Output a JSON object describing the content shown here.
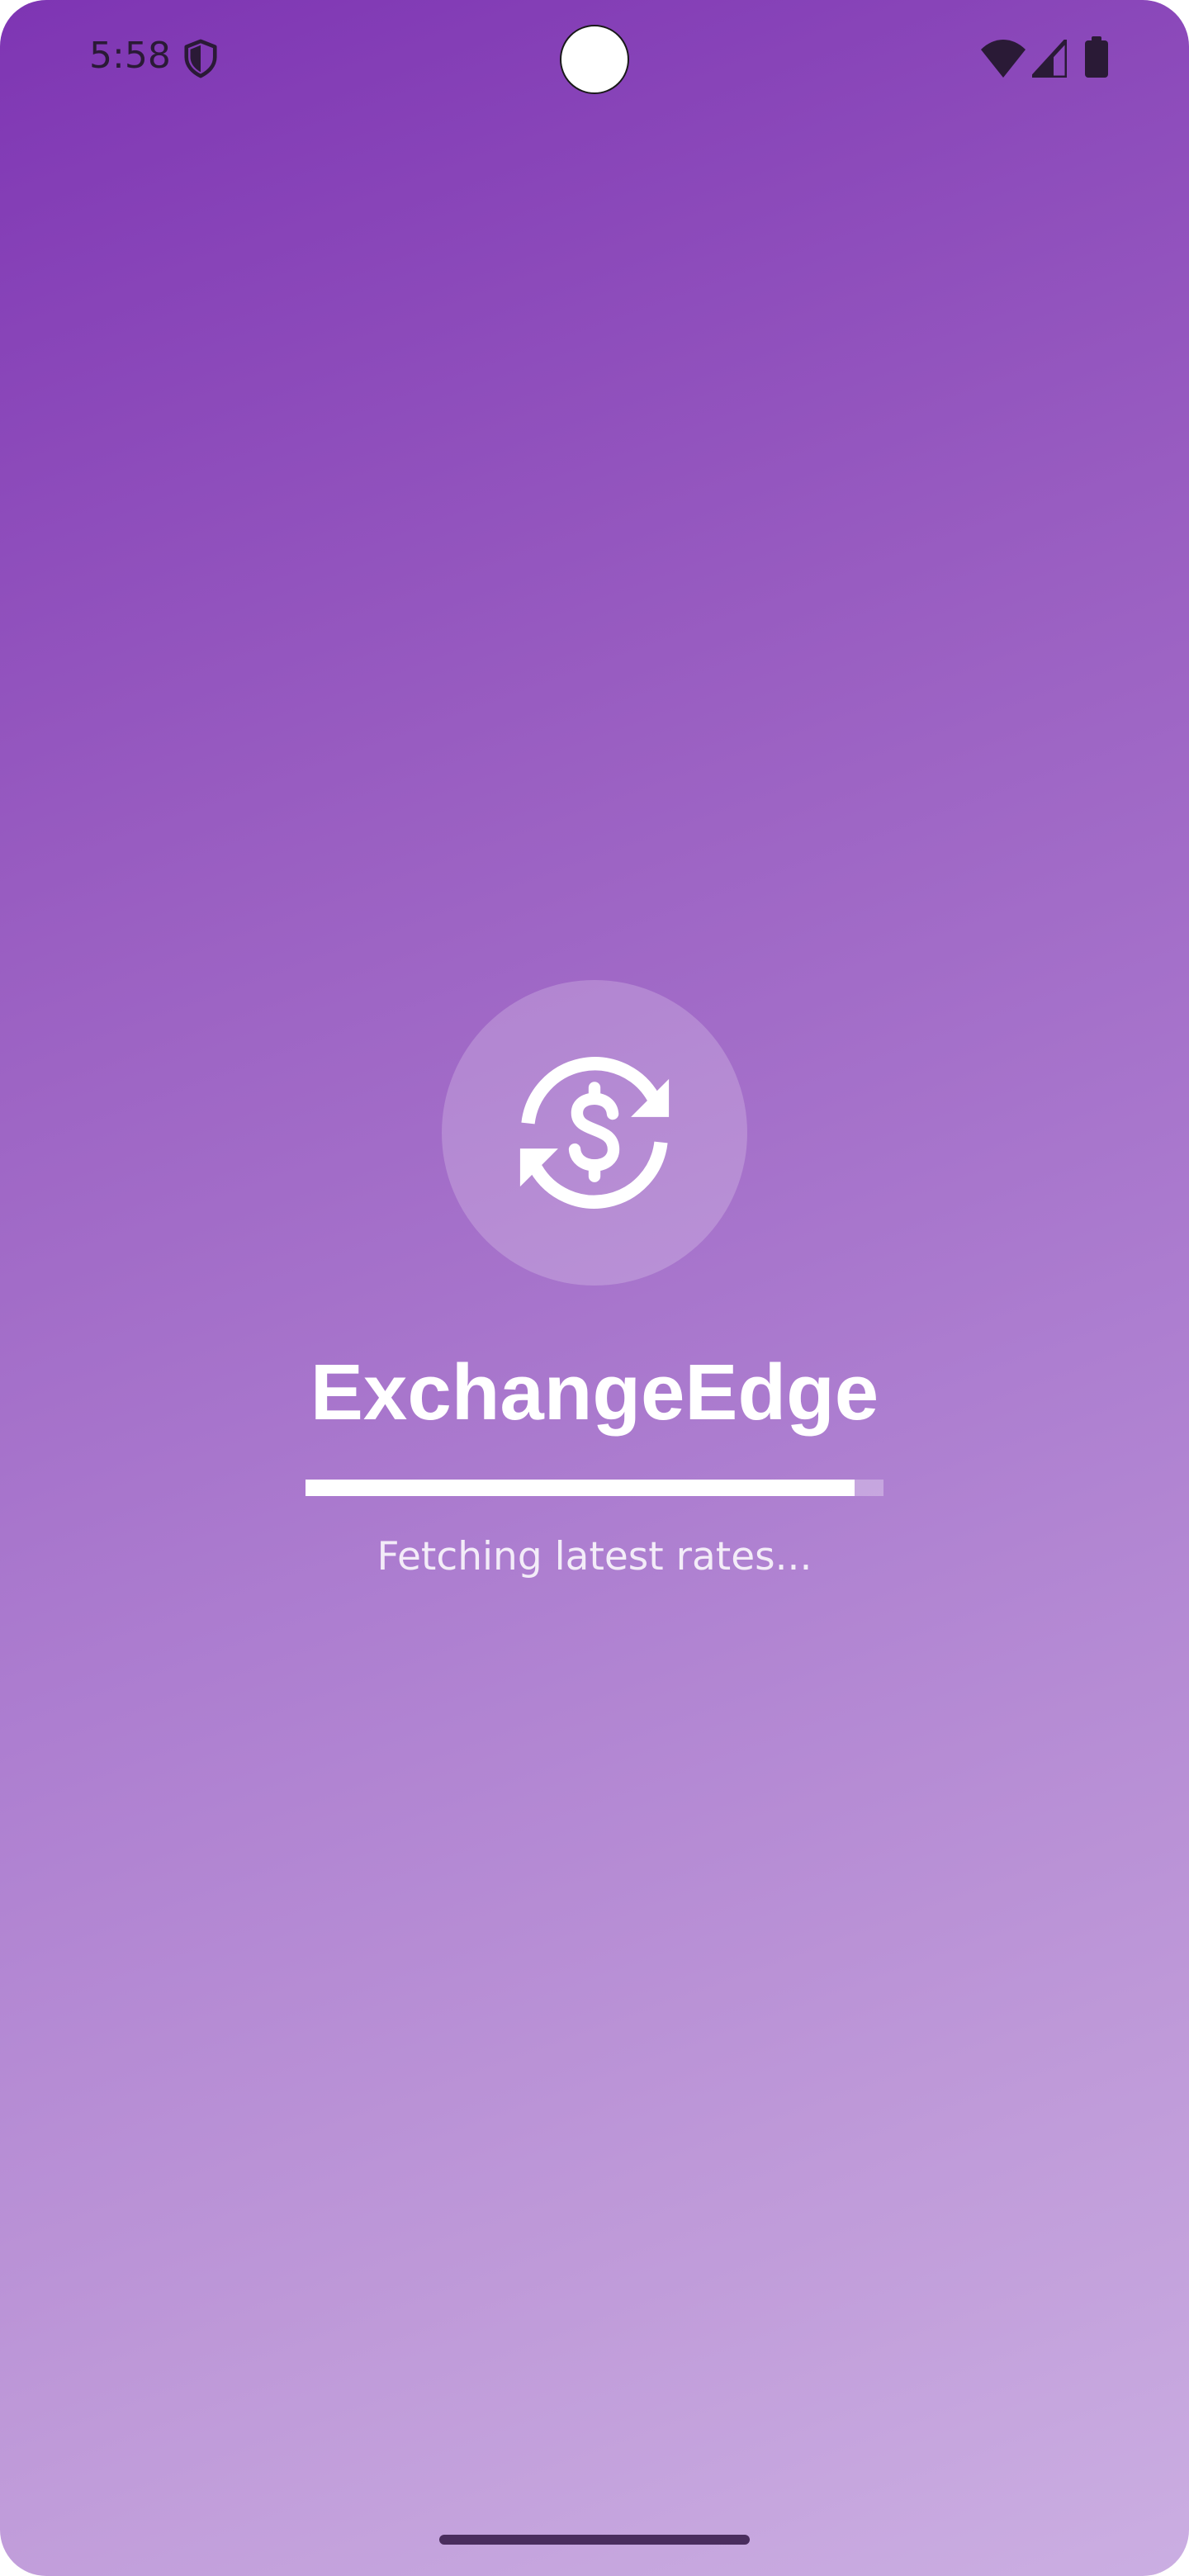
{
  "status_bar": {
    "time": "5:58",
    "icons": [
      "shield-icon",
      "wifi-icon",
      "signal-icon",
      "battery-icon"
    ]
  },
  "splash": {
    "logo_icon": "currency-exchange-icon",
    "app_name": "ExchangeEdge",
    "progress": 0.95,
    "loading_text": "Fetching latest rates..."
  },
  "colors": {
    "gradient_start": "#7e35b3",
    "gradient_end": "#cbaee2",
    "foreground": "#ffffff"
  }
}
